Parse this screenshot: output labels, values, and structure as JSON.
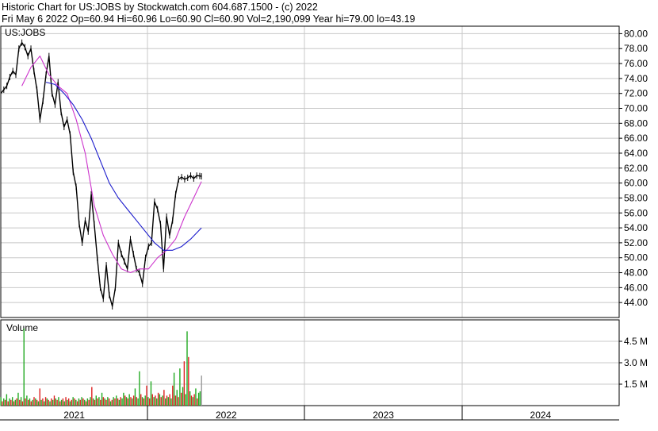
{
  "header": {
    "line1": "Historic Chart for US:JOBS by Stockwatch.com 604.687.1500 - (c) 2022",
    "line2": "Fri May  6 2022  Op=60.94  Hi=60.96  Lo=60.90  Cl=60.90  Vol=2,190,099  Year hi=79.00  lo=43.19"
  },
  "colors": {
    "price": "#000000",
    "ma_fast": "#cc33cc",
    "ma_slow": "#1a1acc",
    "vol_up": "#22aa22",
    "vol_down": "#dd2222",
    "vol_last": "#999999",
    "grid": "#c8c8c8"
  },
  "chart_data": [
    {
      "type": "line",
      "panel": "price",
      "label": "US:JOBS",
      "ylim": [
        42,
        81
      ],
      "yticks": [
        "80.00",
        "78.00",
        "76.00",
        "74.00",
        "72.00",
        "70.00",
        "68.00",
        "66.00",
        "64.00",
        "62.00",
        "60.00",
        "58.00",
        "56.00",
        "54.00",
        "52.00",
        "50.00",
        "48.00",
        "46.00",
        "44.00"
      ],
      "ytick_values": [
        80,
        78,
        76,
        74,
        72,
        70,
        68,
        66,
        64,
        62,
        60,
        58,
        56,
        54,
        52,
        50,
        48,
        46,
        44
      ],
      "x_start": "2021-01-25",
      "x_end": "2024-12-31",
      "xticks": [
        {
          "label": "2021",
          "date": "2021-01-01",
          "center": "2021-07-01"
        },
        {
          "label": "2022",
          "date": "2022-01-01",
          "center": "2022-07-01"
        },
        {
          "label": "2023",
          "date": "2023-01-01",
          "center": "2023-07-01"
        },
        {
          "label": "2024",
          "date": "2024-01-01",
          "center": "2024-07-01"
        }
      ],
      "series": [
        {
          "role": "price",
          "x": [
            "2021-01-25",
            "2021-02-01",
            "2021-02-08",
            "2021-02-15",
            "2021-02-22",
            "2021-03-01",
            "2021-03-08",
            "2021-03-15",
            "2021-03-22",
            "2021-03-29",
            "2021-04-05",
            "2021-04-12",
            "2021-04-19",
            "2021-04-26",
            "2021-05-03",
            "2021-05-10",
            "2021-05-17",
            "2021-05-24",
            "2021-05-31",
            "2021-06-07",
            "2021-06-14",
            "2021-06-21",
            "2021-06-28",
            "2021-07-05",
            "2021-07-12",
            "2021-07-19",
            "2021-07-26",
            "2021-08-02",
            "2021-08-09",
            "2021-08-16",
            "2021-08-23",
            "2021-08-30",
            "2021-09-06",
            "2021-09-13",
            "2021-09-20",
            "2021-09-27",
            "2021-10-04",
            "2021-10-11",
            "2021-10-18",
            "2021-10-25",
            "2021-11-01",
            "2021-11-08",
            "2021-11-15",
            "2021-11-22",
            "2021-11-29",
            "2021-12-06",
            "2021-12-13",
            "2021-12-20",
            "2021-12-27",
            "2022-01-03",
            "2022-01-10",
            "2022-01-17",
            "2022-01-24",
            "2022-01-31",
            "2022-02-07",
            "2022-02-14",
            "2022-02-21",
            "2022-02-28",
            "2022-03-07",
            "2022-03-14",
            "2022-03-21",
            "2022-03-28",
            "2022-04-04",
            "2022-04-11",
            "2022-04-18",
            "2022-04-25",
            "2022-05-02",
            "2022-05-06"
          ],
          "y": [
            72.0,
            72.5,
            73.0,
            74.2,
            75.0,
            74.5,
            78.0,
            78.8,
            78.2,
            77.0,
            78.0,
            75.0,
            72.5,
            68.5,
            71.0,
            74.5,
            77.0,
            72.0,
            70.5,
            73.5,
            69.5,
            67.5,
            68.5,
            66.5,
            61.5,
            59.5,
            54.5,
            52.0,
            55.0,
            53.5,
            58.5,
            54.5,
            50.0,
            46.0,
            44.5,
            49.0,
            45.0,
            43.5,
            46.0,
            52.0,
            50.5,
            49.5,
            48.5,
            52.5,
            50.5,
            48.5,
            48.0,
            46.5,
            50.0,
            51.5,
            52.0,
            57.5,
            56.5,
            54.5,
            48.5,
            55.5,
            53.0,
            55.0,
            58.5,
            60.5,
            60.8,
            60.5,
            60.7,
            61.0,
            60.6,
            61.0,
            60.95,
            60.9
          ]
        },
        {
          "role": "ma_fast",
          "x": [
            "2021-03-15",
            "2021-04-05",
            "2021-04-26",
            "2021-05-17",
            "2021-06-07",
            "2021-06-28",
            "2021-07-19",
            "2021-08-09",
            "2021-08-30",
            "2021-09-20",
            "2021-10-11",
            "2021-11-01",
            "2021-11-22",
            "2021-12-13",
            "2022-01-03",
            "2022-01-24",
            "2022-02-14",
            "2022-03-07",
            "2022-03-28",
            "2022-04-18",
            "2022-05-06"
          ],
          "y": [
            73.0,
            75.5,
            77.0,
            74.5,
            73.0,
            72.0,
            68.5,
            64.0,
            57.0,
            53.0,
            50.5,
            48.5,
            48.0,
            48.5,
            48.5,
            50.0,
            51.0,
            52.5,
            55.5,
            58.0,
            60.2
          ]
        },
        {
          "role": "ma_slow",
          "x": [
            "2021-05-10",
            "2021-05-31",
            "2021-06-21",
            "2021-07-12",
            "2021-08-02",
            "2021-08-23",
            "2021-09-13",
            "2021-10-04",
            "2021-10-25",
            "2021-11-15",
            "2021-12-06",
            "2021-12-27",
            "2022-01-17",
            "2022-02-07",
            "2022-02-28",
            "2022-03-21",
            "2022-04-11",
            "2022-05-06"
          ],
          "y": [
            73.5,
            73.2,
            72.0,
            70.5,
            68.5,
            66.0,
            63.0,
            60.0,
            58.0,
            56.5,
            55.0,
            53.5,
            52.0,
            51.0,
            51.0,
            51.5,
            52.5,
            54.0
          ]
        }
      ]
    },
    {
      "type": "bar",
      "panel": "volume",
      "label": "Volume",
      "ylim": [
        0,
        6000000
      ],
      "yticks": [
        "4.5 M",
        "3.0 M",
        "1.5 M"
      ],
      "ytick_values": [
        4500000,
        3000000,
        1500000
      ],
      "bars": [
        [
          0.6,
          "u"
        ],
        [
          0.3,
          "d"
        ],
        [
          0.5,
          "u"
        ],
        [
          0.4,
          "d"
        ],
        [
          0.8,
          "u"
        ],
        [
          0.3,
          "d"
        ],
        [
          0.5,
          "u"
        ],
        [
          0.4,
          "d"
        ],
        [
          0.6,
          "u"
        ],
        [
          0.3,
          "d"
        ],
        [
          0.4,
          "u"
        ],
        [
          0.5,
          "d"
        ],
        [
          0.9,
          "u"
        ],
        [
          0.4,
          "d"
        ],
        [
          0.6,
          "u"
        ],
        [
          0.3,
          "d"
        ],
        [
          5.4,
          "u"
        ],
        [
          0.5,
          "d"
        ],
        [
          0.7,
          "u"
        ],
        [
          0.4,
          "d"
        ],
        [
          0.5,
          "u"
        ],
        [
          0.3,
          "d"
        ],
        [
          0.4,
          "u"
        ],
        [
          0.6,
          "d"
        ],
        [
          0.5,
          "u"
        ],
        [
          0.4,
          "d"
        ],
        [
          0.3,
          "u"
        ],
        [
          1.2,
          "d"
        ],
        [
          0.4,
          "u"
        ],
        [
          0.5,
          "d"
        ],
        [
          0.3,
          "u"
        ],
        [
          0.6,
          "d"
        ],
        [
          0.5,
          "u"
        ],
        [
          0.4,
          "d"
        ],
        [
          0.3,
          "u"
        ],
        [
          0.5,
          "d"
        ],
        [
          0.4,
          "u"
        ],
        [
          0.7,
          "d"
        ],
        [
          0.5,
          "u"
        ],
        [
          0.4,
          "d"
        ],
        [
          0.6,
          "u"
        ],
        [
          0.3,
          "d"
        ],
        [
          0.4,
          "u"
        ],
        [
          0.5,
          "d"
        ],
        [
          0.3,
          "u"
        ],
        [
          0.6,
          "d"
        ],
        [
          0.4,
          "u"
        ],
        [
          0.5,
          "d"
        ],
        [
          0.3,
          "u"
        ],
        [
          0.4,
          "d"
        ],
        [
          0.6,
          "u"
        ],
        [
          0.5,
          "d"
        ],
        [
          0.4,
          "u"
        ],
        [
          0.3,
          "d"
        ],
        [
          0.5,
          "u"
        ],
        [
          0.4,
          "d"
        ],
        [
          0.6,
          "u"
        ],
        [
          0.5,
          "d"
        ],
        [
          0.4,
          "u"
        ],
        [
          0.3,
          "d"
        ],
        [
          0.5,
          "u"
        ],
        [
          0.4,
          "d"
        ],
        [
          0.6,
          "u"
        ],
        [
          1.3,
          "d"
        ],
        [
          0.5,
          "u"
        ],
        [
          0.4,
          "d"
        ],
        [
          0.7,
          "u"
        ],
        [
          0.5,
          "d"
        ],
        [
          0.6,
          "u"
        ],
        [
          0.4,
          "d"
        ],
        [
          0.9,
          "u"
        ],
        [
          0.6,
          "d"
        ],
        [
          0.5,
          "u"
        ],
        [
          0.4,
          "d"
        ],
        [
          0.6,
          "u"
        ],
        [
          0.5,
          "d"
        ],
        [
          0.3,
          "u"
        ],
        [
          0.4,
          "d"
        ],
        [
          0.6,
          "u"
        ],
        [
          0.5,
          "d"
        ],
        [
          0.7,
          "u"
        ],
        [
          0.5,
          "d"
        ],
        [
          0.4,
          "u"
        ],
        [
          0.6,
          "d"
        ],
        [
          0.5,
          "u"
        ],
        [
          0.9,
          "u"
        ],
        [
          0.7,
          "d"
        ],
        [
          0.6,
          "u"
        ],
        [
          0.5,
          "d"
        ],
        [
          0.8,
          "u"
        ],
        [
          0.6,
          "d"
        ],
        [
          0.5,
          "u"
        ],
        [
          0.7,
          "d"
        ],
        [
          1.2,
          "u"
        ],
        [
          0.6,
          "d"
        ],
        [
          0.5,
          "u"
        ],
        [
          2.4,
          "u"
        ],
        [
          0.8,
          "d"
        ],
        [
          0.6,
          "u"
        ],
        [
          0.5,
          "d"
        ],
        [
          0.7,
          "u"
        ],
        [
          1.4,
          "d"
        ],
        [
          0.6,
          "u"
        ],
        [
          0.5,
          "d"
        ],
        [
          1.7,
          "u"
        ],
        [
          0.8,
          "d"
        ],
        [
          0.6,
          "u"
        ],
        [
          0.7,
          "d"
        ],
        [
          0.5,
          "u"
        ],
        [
          0.9,
          "d"
        ],
        [
          0.8,
          "u"
        ],
        [
          0.6,
          "d"
        ],
        [
          0.7,
          "u"
        ],
        [
          1.1,
          "d"
        ],
        [
          0.5,
          "u"
        ],
        [
          0.7,
          "d"
        ],
        [
          0.6,
          "u"
        ],
        [
          0.8,
          "d"
        ],
        [
          0.5,
          "u"
        ],
        [
          1.4,
          "d"
        ],
        [
          2.3,
          "u"
        ],
        [
          0.7,
          "d"
        ],
        [
          1.1,
          "u"
        ],
        [
          0.6,
          "d"
        ],
        [
          2.6,
          "u"
        ],
        [
          0.9,
          "d"
        ],
        [
          1.3,
          "u"
        ],
        [
          3.1,
          "d"
        ],
        [
          0.8,
          "u"
        ],
        [
          5.2,
          "u"
        ],
        [
          3.4,
          "d"
        ],
        [
          1.0,
          "u"
        ],
        [
          0.7,
          "d"
        ],
        [
          0.6,
          "u"
        ],
        [
          0.8,
          "d"
        ],
        [
          1.2,
          "u"
        ],
        [
          0.5,
          "d"
        ],
        [
          0.9,
          "u"
        ],
        [
          1.0,
          "u"
        ],
        [
          2.1,
          "l"
        ]
      ]
    }
  ]
}
